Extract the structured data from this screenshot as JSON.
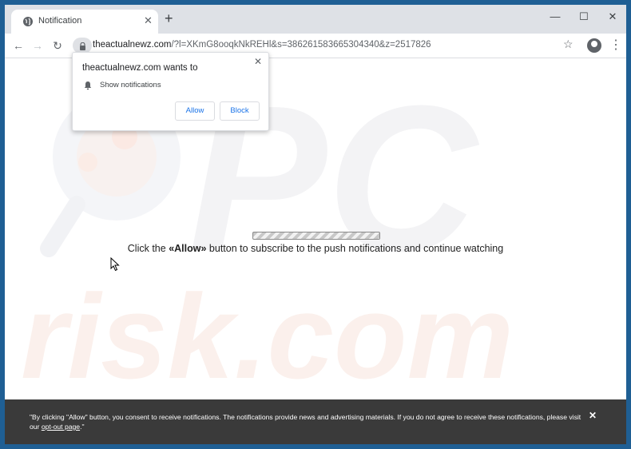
{
  "tab": {
    "title": "Notification",
    "close": "✕"
  },
  "newtab": "+",
  "window_controls": {
    "minimize": "—",
    "maximize": "☐",
    "close": "✕"
  },
  "nav": {
    "back": "←",
    "forward": "→",
    "reload": "↻"
  },
  "address": {
    "domain": "theactualnewz.com",
    "path": "/?l=XKmG8ooqkNkREHl&s=386261583665304340&z=2517826"
  },
  "toolbar": {
    "star": "☆",
    "menu": "⋮"
  },
  "popup": {
    "title": "theactualnewz.com wants to",
    "permission": "Show notifications",
    "allow": "Allow",
    "block": "Block",
    "close": "✕"
  },
  "message": {
    "before": "Click the ",
    "strong": "«Allow»",
    "after": " button to subscribe to the push notifications and continue watching"
  },
  "banner": {
    "text_before": "\"By clicking \"Allow\" button, you consent to receive notifications. The notifications provide news and advertising materials. If you do not agree to receive these notifications, please visit our ",
    "link": "opt-out page",
    "text_after": ".\"",
    "close": "✕"
  },
  "watermark": {
    "top": "PC",
    "bottom": "risk.com"
  },
  "colors": {
    "frame": "#1f5f94",
    "tabstrip": "#dee1e6",
    "banner": "#3a3a3a",
    "accent": "#1a73e8"
  },
  "icons": {
    "favicon": "globe-icon",
    "permission": "bell-icon",
    "lock": "lock-icon"
  }
}
